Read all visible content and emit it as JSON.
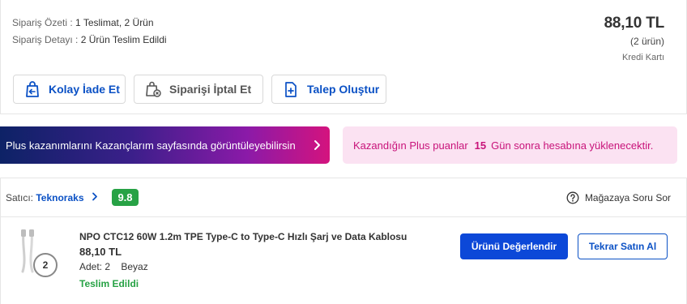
{
  "order_summary": {
    "summary_label": "Sipariş Özeti :",
    "summary_value": "1 Teslimat, 2 Ürün",
    "detail_label": "Sipariş Detayı :",
    "detail_value": "2 Ürün Teslim Edildi",
    "total": "88,10 TL",
    "item_count": "(2 ürün)",
    "payment_method": "Kredi Kartı"
  },
  "actions": {
    "return_label": "Kolay İade Et",
    "cancel_label": "Siparişi İptal Et",
    "request_label": "Talep Oluştur"
  },
  "plus": {
    "banner_text": "Plus kazanımlarını Kazançlarım sayfasında görüntüleyebilirsin",
    "points_prefix": "Kazandığın Plus puanlar",
    "points_days": "15",
    "points_suffix": "Gün sonra hesabına yüklenecektir."
  },
  "seller": {
    "label": "Satıcı:",
    "name": "Teknoraks",
    "score": "9.8",
    "ask_label": "Mağazaya Soru Sor"
  },
  "product": {
    "name": "NPO CTC12 60W 1.2m TPE Type-C to Type-C Hızlı Şarj ve Data Kablosu",
    "price": "88,10 TL",
    "quantity": "Adet: 2",
    "color": "Beyaz",
    "status": "Teslim Edildi",
    "qty_badge": "2",
    "review_label": "Ürünü Değerlendir",
    "rebuy_label": "Tekrar Satın Al"
  },
  "colors": {
    "brand_blue": "#0b51c5",
    "success_green": "#27a245",
    "plus_pink": "#c8137a"
  }
}
